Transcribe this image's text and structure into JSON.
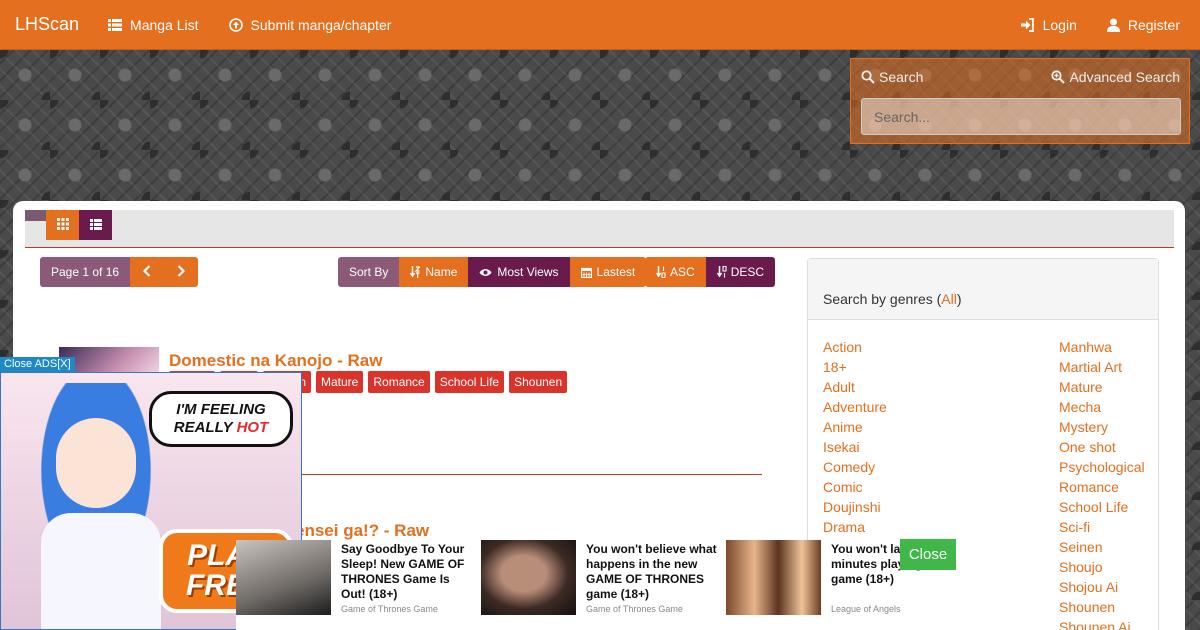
{
  "navbar": {
    "brand": "LHScan",
    "links": [
      {
        "label": "Manga List",
        "icon": "list-icon"
      },
      {
        "label": "Submit manga/chapter",
        "icon": "upload-icon"
      }
    ],
    "right": [
      {
        "label": "Login",
        "icon": "login-icon"
      },
      {
        "label": "Register",
        "icon": "user-icon"
      }
    ],
    "color": "#e46f1e"
  },
  "search": {
    "label": "Search",
    "advanced_label": "Advanced Search",
    "placeholder": "Search..."
  },
  "pager": {
    "info": "Page 1 of 16"
  },
  "sort": {
    "label": "Sort By",
    "name": "Name",
    "most_views": "Most Views",
    "latest": "Lastest",
    "asc": "ASC",
    "desc": "DESC"
  },
  "manga": [
    {
      "title": "Domestic na Kanojo - Raw",
      "genres": [
        "",
        "",
        "",
        "Mature",
        "Romance",
        "School Life",
        "Shounen"
      ],
      "visible_genre_fragment": "n"
    },
    {
      "title_fragment": "ensei ga!? - Raw"
    }
  ],
  "genres_panel": {
    "heading_prefix": "Search by genres (",
    "all": "All",
    "heading_suffix": ")",
    "col1": [
      "Action",
      "18+",
      "Adult",
      "Adventure",
      "Anime",
      "Isekai",
      "Comedy",
      "Comic",
      "Doujinshi",
      "Drama"
    ],
    "col2": [
      "Manhwa",
      "Martial Art",
      "Mature",
      "Mecha",
      "Mystery",
      "One shot",
      "Psychological",
      "Romance",
      "School Life",
      "Sci-fi",
      "Seinen",
      "Shoujo",
      "Shojou Ai",
      "Shounen",
      "Shounen Ai"
    ]
  },
  "ads": {
    "close_ads": "Close ADS[X]",
    "bubble_line1": "I'M FEELING",
    "bubble_line2": "REALLY",
    "bubble_hot": "HOT",
    "play_line1": "PLAY",
    "play_line2": "FREE",
    "close": "Close",
    "items": [
      {
        "text": "Say Goodbye To Your Sleep! New GAME OF THRONES Game Is Out! (18+)",
        "source": "Game of Thrones Game"
      },
      {
        "text": "You won't believe what happens in the new GAME OF THRONES game (18+)",
        "source": "Game of Thrones Game"
      },
      {
        "text": "You won't last 2 minutes playing this game (18+)",
        "source": "League of Angels"
      }
    ]
  }
}
